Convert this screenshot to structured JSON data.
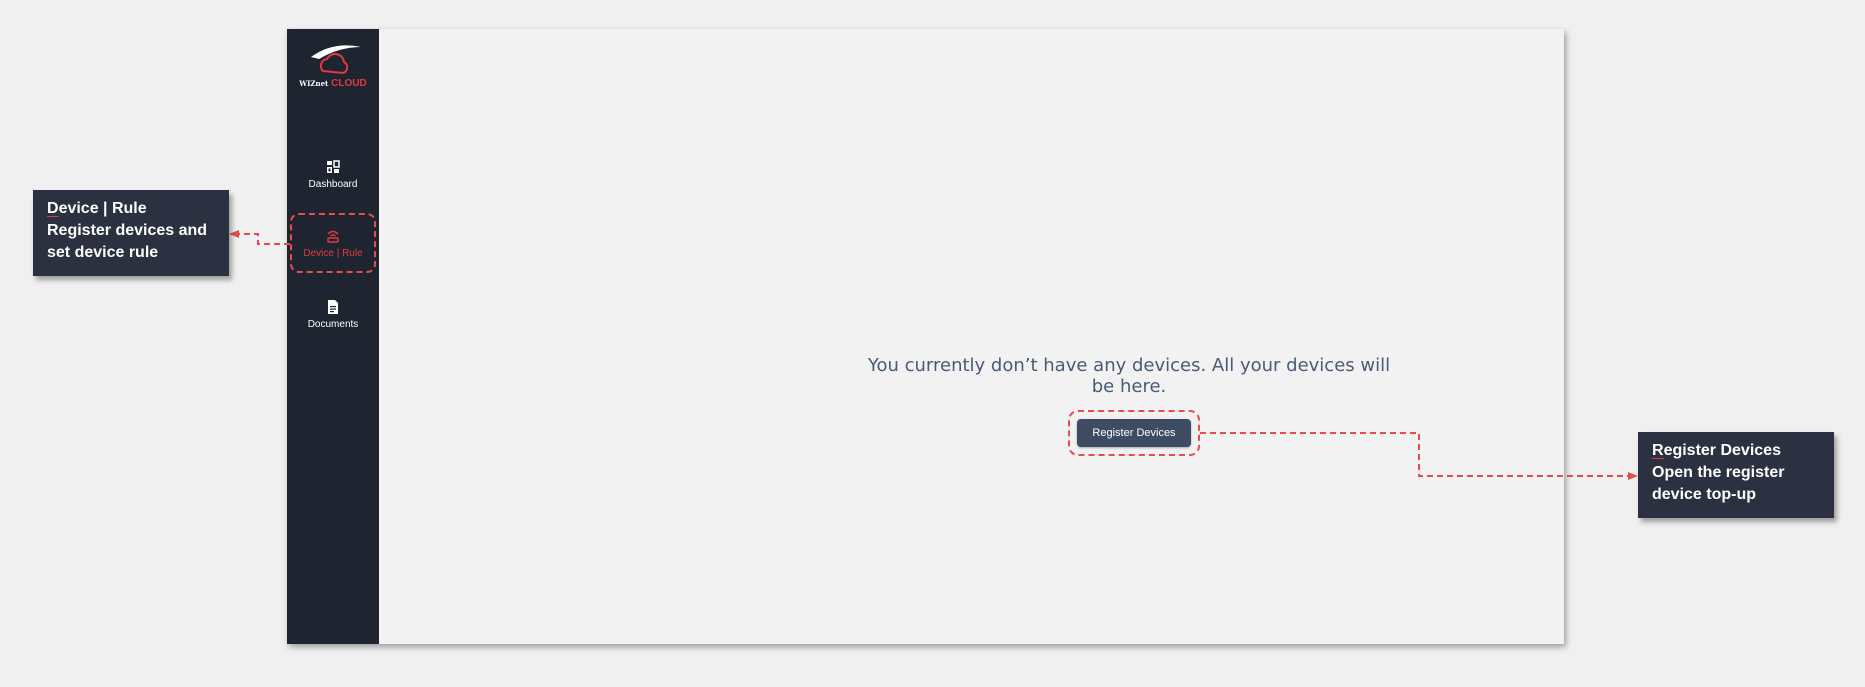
{
  "sidebar": {
    "logo": {
      "brand_prefix": "WIZnet",
      "brand_suffix": "CLOUD"
    },
    "items": [
      {
        "label": "Dashboard",
        "icon": "dashboard-icon",
        "active": false
      },
      {
        "label": "Device | Rule",
        "icon": "router-icon",
        "active": true
      },
      {
        "label": "Documents",
        "icon": "document-icon",
        "active": false
      }
    ]
  },
  "main": {
    "empty_message": "You currently don’t have any devices. All your devices will be here.",
    "register_button_label": "Register Devices"
  },
  "callouts": {
    "left": {
      "title_first_letter": "D",
      "title_rest": "evice | Rule",
      "description": "Register devices and set device rule"
    },
    "right": {
      "title_first_letter": "R",
      "title_rest": "egister Devices",
      "description": "Open the register device top-up"
    }
  },
  "colors": {
    "sidebar_bg": "#1f2431",
    "accent": "#e03a3e",
    "button_bg": "#3d4b63",
    "callout_bg": "#2b3140",
    "highlight": "#e84c4f"
  }
}
